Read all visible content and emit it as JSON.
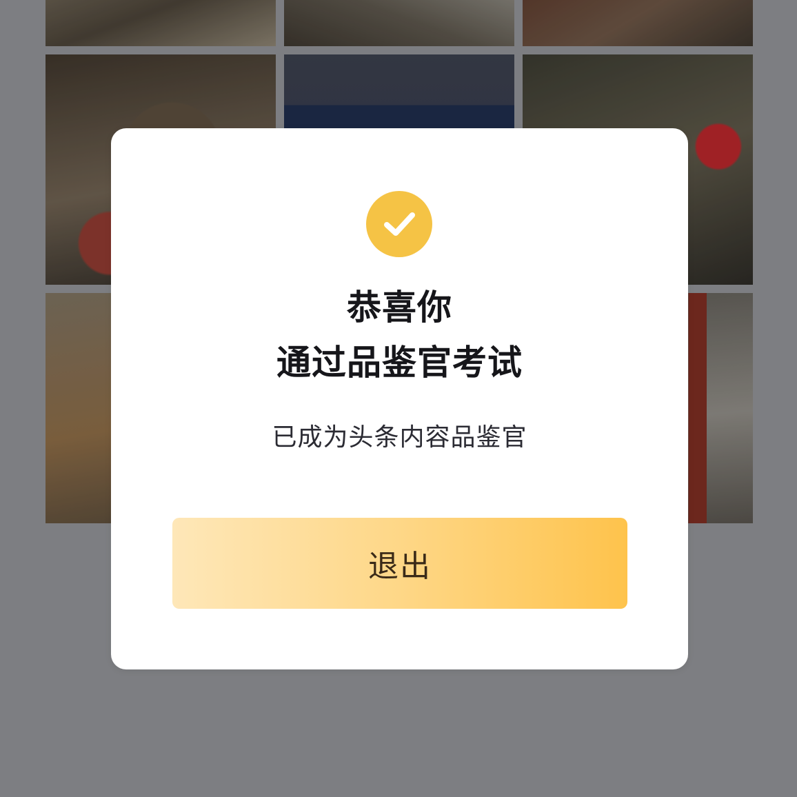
{
  "modal": {
    "title_line_1": "恭喜你",
    "title_line_2": "通过品鉴官考试",
    "subtitle": "已成为头条内容品鉴官",
    "exit_label": "退出",
    "icon": "checkmark-circle-icon"
  },
  "colors": {
    "accent": "#f5c345",
    "button_gradient_start": "#fee7b8",
    "button_gradient_end": "#fec34c",
    "overlay": "#7d7e82"
  }
}
